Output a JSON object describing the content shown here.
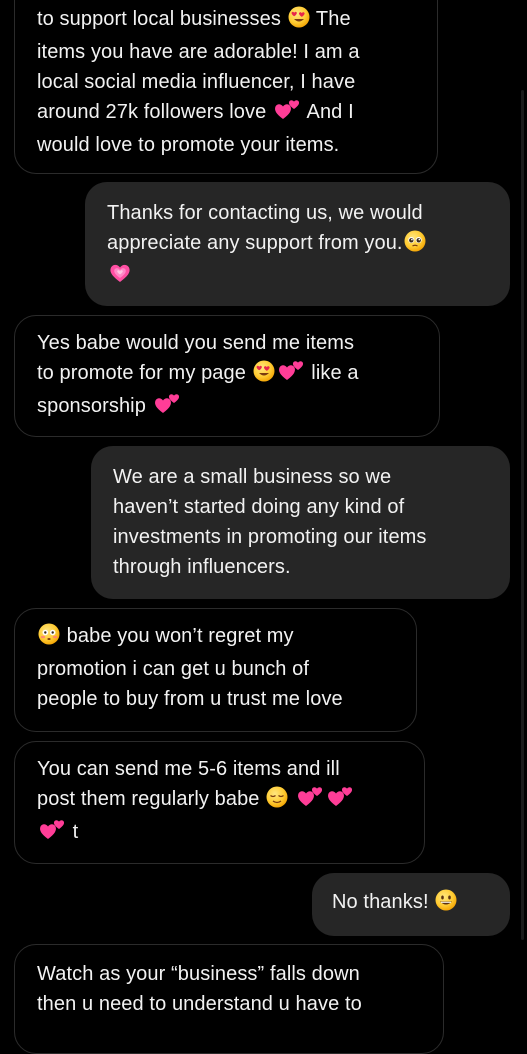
{
  "messages": [
    {
      "id": "m1",
      "side": "incoming",
      "lines": [
        [
          "to support local businesses ",
          {
            "emoji": "heart-eyes"
          },
          " The"
        ],
        [
          "items you have are adorable! I am a"
        ],
        [
          "local social media influencer, I have"
        ],
        [
          "around 27k followers love ",
          {
            "emoji": "two-hearts"
          },
          " And I"
        ],
        [
          "would love to promote your items."
        ]
      ]
    },
    {
      "id": "m2",
      "side": "outgoing",
      "lines": [
        [
          "Thanks for contacting us, we would"
        ],
        [
          "appreciate any support from you.",
          {
            "emoji": "pleading-face"
          }
        ],
        [
          {
            "emoji": "growing-heart"
          }
        ]
      ]
    },
    {
      "id": "m3",
      "side": "incoming",
      "lines": [
        [
          "Yes babe would you send me items"
        ],
        [
          "to promote for my page ",
          {
            "emoji": "heart-eyes"
          },
          {
            "emoji": "two-hearts"
          },
          " like a"
        ],
        [
          "sponsorship ",
          {
            "emoji": "two-hearts"
          }
        ]
      ]
    },
    {
      "id": "m4",
      "side": "outgoing",
      "lines": [
        [
          "We are a small business so we"
        ],
        [
          "haven’t started doing any kind of"
        ],
        [
          "investments in promoting our items"
        ],
        [
          "through influencers."
        ]
      ]
    },
    {
      "id": "m5",
      "side": "incoming",
      "lines": [
        [
          {
            "emoji": "flushed-face"
          },
          " babe you won’t regret my"
        ],
        [
          "promotion i can get u bunch of"
        ],
        [
          "people to buy from u trust me love"
        ]
      ]
    },
    {
      "id": "m6",
      "side": "incoming",
      "lines": [
        [
          "You can send me 5-6 items and ill"
        ],
        [
          "post them regularly babe ",
          {
            "emoji": "relieved-face"
          },
          " ",
          {
            "emoji": "two-hearts"
          },
          {
            "emoji": "two-hearts"
          }
        ],
        [
          {
            "emoji": "two-hearts"
          },
          " t"
        ]
      ]
    },
    {
      "id": "m7",
      "side": "outgoing",
      "lines": [
        [
          "No thanks! ",
          {
            "emoji": "smiley-face"
          }
        ]
      ]
    },
    {
      "id": "m8",
      "side": "incoming",
      "lines": [
        [
          "Watch as your “business” falls down"
        ],
        [
          "then u need to understand u have to"
        ]
      ]
    }
  ]
}
